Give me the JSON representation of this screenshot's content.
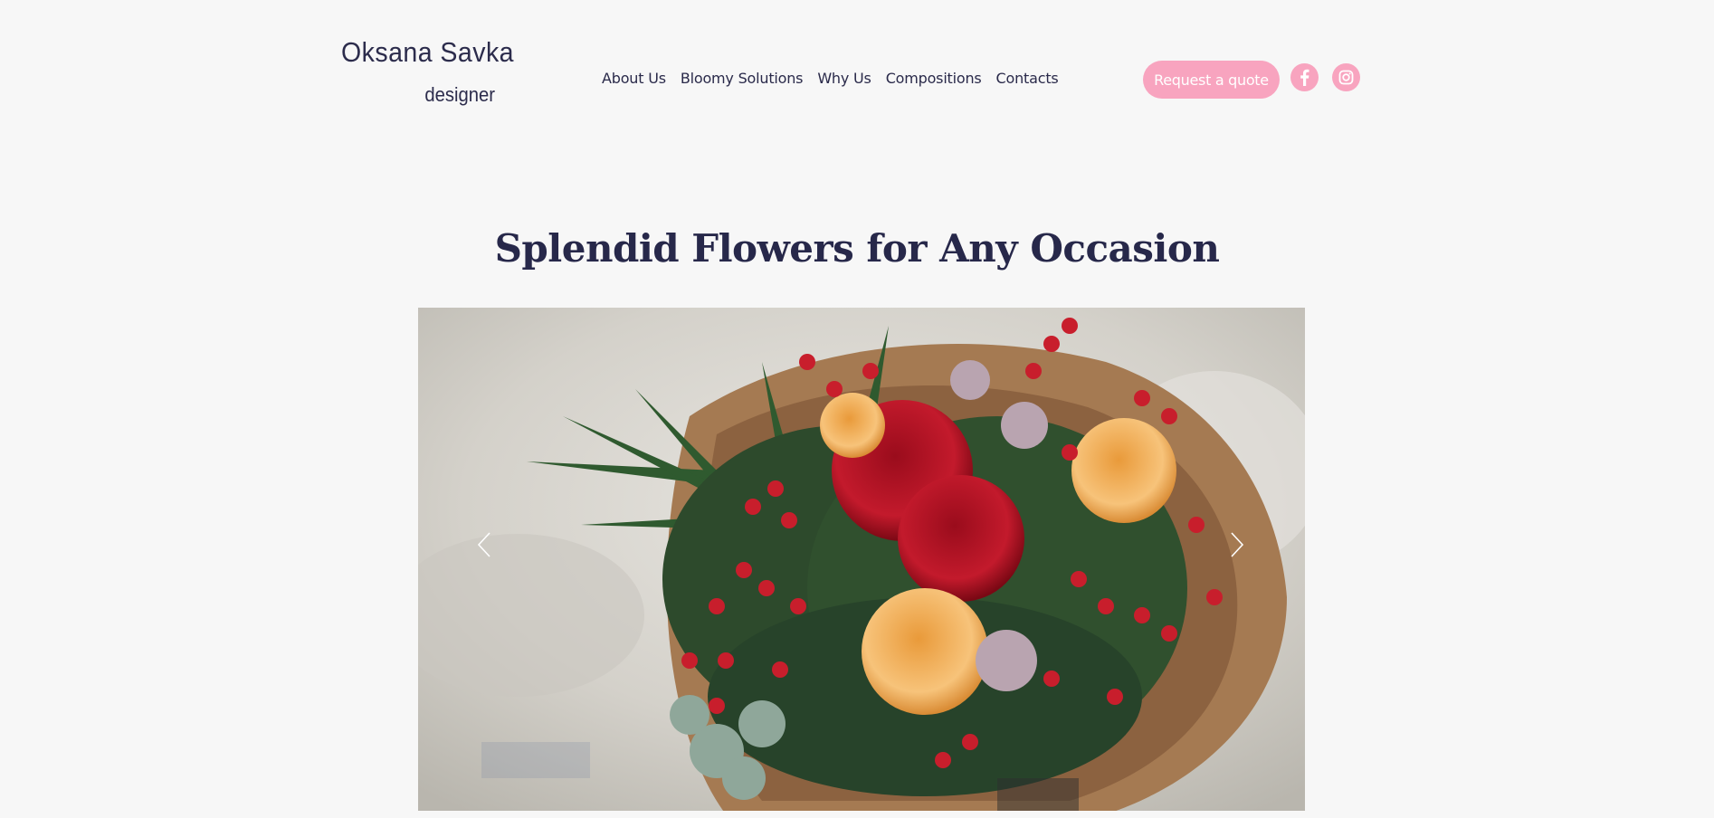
{
  "brand": {
    "name": "Oksana Savka",
    "tagline": "designer"
  },
  "nav": {
    "items": [
      {
        "label": "About Us"
      },
      {
        "label": "Bloomy Solutions"
      },
      {
        "label": "Why Us"
      },
      {
        "label": "Compositions"
      },
      {
        "label": "Contacts"
      }
    ]
  },
  "header": {
    "cta_label": "Request a quote",
    "social": [
      {
        "icon": "facebook-icon"
      },
      {
        "icon": "instagram-icon"
      }
    ]
  },
  "hero": {
    "title": "Splendid Flowers for Any Occasion"
  },
  "slider": {
    "prev_icon": "chevron-left-icon",
    "next_icon": "chevron-right-icon"
  },
  "colors": {
    "accent": "#f8a4bf",
    "text": "#2a2a4a",
    "background": "#f7f7f7"
  }
}
